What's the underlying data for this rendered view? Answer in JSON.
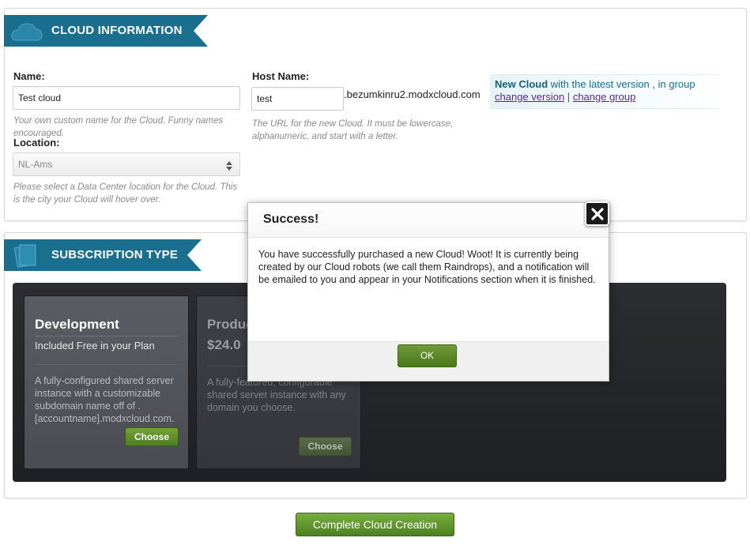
{
  "cloud_info": {
    "title": "CLOUD INFORMATION",
    "name_label": "Name:",
    "name_value": "Test cloud",
    "name_help": "Your own custom name for the Cloud. Funny names encouraged.",
    "location_label": "Location:",
    "location_value": "NL-Ams",
    "location_help": "Please select a Data Center location for the Cloud. This is the city your Cloud will hover over.",
    "host_label": "Host Name:",
    "host_value": "test",
    "host_suffix": ".bezumkinru2.modxcloud.com",
    "host_help": "The URL for the new Cloud. It must be lowercase, alphanumeric, and start with a letter.",
    "new_cloud_strong": "New Cloud",
    "new_cloud_text": " with the latest version , in group",
    "change_version": "change version",
    "separator": "|",
    "change_group": "change group"
  },
  "subscription": {
    "title": "SUBSCRIPTION TYPE",
    "plans": [
      {
        "title": "Development",
        "subtitle": "Included Free in your Plan",
        "description": "A fully-configured shared server instance with a customizable subdomain name off of . [accountname].modxcloud.com.",
        "button": "Choose"
      },
      {
        "title": "Production Account",
        "price": "$24.0",
        "description": "A fully-featured, configurable shared server instance with any domain you choose.",
        "button": "Choose"
      }
    ]
  },
  "complete_button": "Complete Cloud Creation",
  "modal": {
    "title": "Success!",
    "message": "You have successfully purchased a new Cloud! Woot! It is currently being created by our Cloud robots (we call them Raindrops), and a notification will be emailed to you and appear in your Notifications section when it is finished.",
    "ok": "OK"
  },
  "colors": {
    "ribbon": "#1a6e8e",
    "green_button": "#5a8f2b",
    "dark_panel": "#26272a"
  },
  "icons": [
    "cloud-icon",
    "stacked-pages-icon",
    "select-arrows-icon",
    "close-icon"
  ]
}
